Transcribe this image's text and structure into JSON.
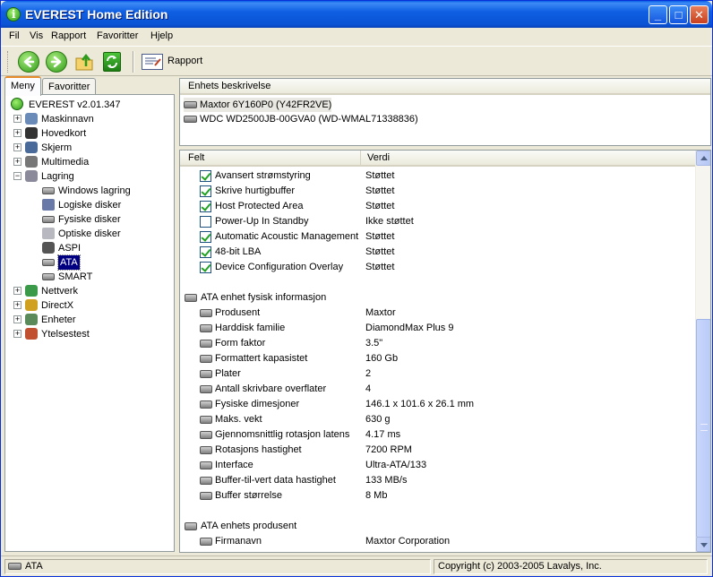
{
  "window": {
    "title": "EVEREST Home Edition"
  },
  "menu": [
    "Fil",
    "Vis",
    "Rapport",
    "Favoritter",
    "Hjelp"
  ],
  "toolbar": {
    "report_label": "Rapport"
  },
  "tabs": {
    "menu": "Meny",
    "favorites": "Favoritter"
  },
  "tree": {
    "root": "EVEREST v2.01.347",
    "items": [
      {
        "label": "Maskinnavn",
        "icon": "computer-icon"
      },
      {
        "label": "Hovedkort",
        "icon": "motherboard-icon"
      },
      {
        "label": "Skjerm",
        "icon": "monitor-icon"
      },
      {
        "label": "Multimedia",
        "icon": "multimedia-icon"
      },
      {
        "label": "Lagring",
        "icon": "storage-icon"
      },
      {
        "label": "Windows lagring",
        "icon": "hdd-icon"
      },
      {
        "label": "Logiske disker",
        "icon": "logical-disk-icon"
      },
      {
        "label": "Fysiske disker",
        "icon": "hdd-icon"
      },
      {
        "label": "Optiske disker",
        "icon": "optical-disk-icon"
      },
      {
        "label": "ASPI",
        "icon": "aspi-icon"
      },
      {
        "label": "ATA",
        "icon": "hdd-icon"
      },
      {
        "label": "SMART",
        "icon": "hdd-icon"
      },
      {
        "label": "Nettverk",
        "icon": "network-icon"
      },
      {
        "label": "DirectX",
        "icon": "directx-icon"
      },
      {
        "label": "Enheter",
        "icon": "devices-icon"
      },
      {
        "label": "Ytelsestest",
        "icon": "hourglass-icon"
      }
    ]
  },
  "devices": {
    "header": "Enhets beskrivelse",
    "items": [
      "Maxtor 6Y160P0 (Y42FR2VE)",
      "WDC WD2500JB-00GVA0 (WD-WMAL71338836)"
    ]
  },
  "details": {
    "col_field": "Felt",
    "col_value": "Verdi",
    "features": [
      {
        "field": "Avansert strømstyring",
        "value": "Støttet",
        "checked": true
      },
      {
        "field": "Skrive hurtigbuffer",
        "value": "Støttet",
        "checked": true
      },
      {
        "field": "Host Protected Area",
        "value": "Støttet",
        "checked": true
      },
      {
        "field": "Power-Up In Standby",
        "value": "Ikke støttet",
        "checked": false
      },
      {
        "field": "Automatic Acoustic Management",
        "value": "Støttet",
        "checked": true
      },
      {
        "field": "48-bit LBA",
        "value": "Støttet",
        "checked": true
      },
      {
        "field": "Device Configuration Overlay",
        "value": "Støttet",
        "checked": true
      }
    ],
    "section_physical": "ATA enhet fysisk informasjon",
    "physical": [
      {
        "field": "Produsent",
        "value": "Maxtor"
      },
      {
        "field": "Harddisk familie",
        "value": "DiamondMax Plus 9"
      },
      {
        "field": "Form faktor",
        "value": "3.5\""
      },
      {
        "field": "Formattert kapasistet",
        "value": "160 Gb"
      },
      {
        "field": "Plater",
        "value": "2"
      },
      {
        "field": "Antall skrivbare overflater",
        "value": "4"
      },
      {
        "field": "Fysiske dimesjoner",
        "value": "146.1 x 101.6 x 26.1 mm"
      },
      {
        "field": "Maks. vekt",
        "value": "630 g"
      },
      {
        "field": "Gjennomsnittlig rotasjon latens",
        "value": "4.17 ms"
      },
      {
        "field": "Rotasjons hastighet",
        "value": "7200 RPM"
      },
      {
        "field": "Interface",
        "value": "Ultra-ATA/133"
      },
      {
        "field": "Buffer-til-vert data hastighet",
        "value": "133 MB/s"
      },
      {
        "field": "Buffer størrelse",
        "value": "8 Mb"
      }
    ],
    "section_manufacturer": "ATA enhets produsent",
    "manufacturer": [
      {
        "field": "Firmanavn",
        "value": "Maxtor Corporation"
      }
    ]
  },
  "status": {
    "left": "ATA",
    "right": "Copyright (c) 2003-2005 Lavalys, Inc."
  }
}
